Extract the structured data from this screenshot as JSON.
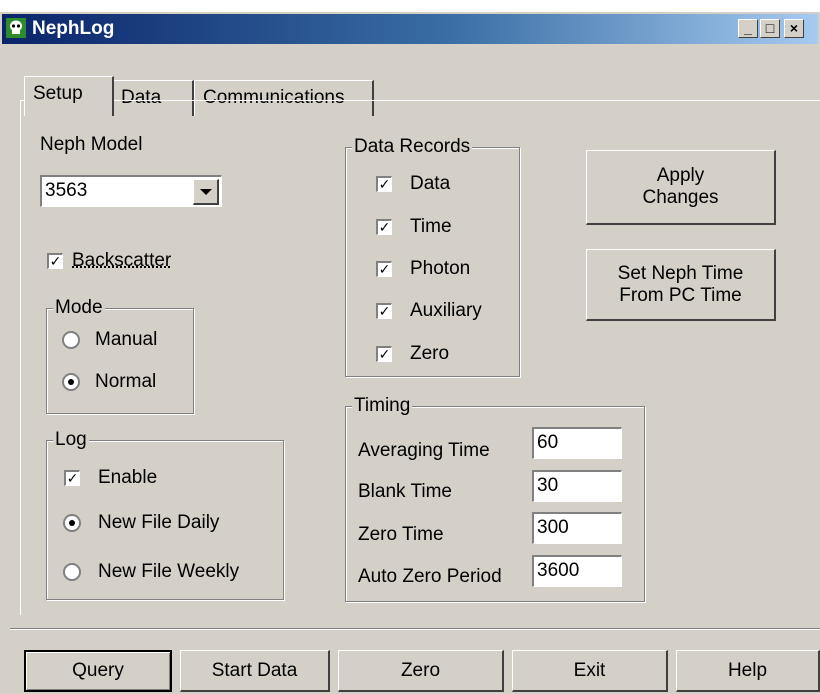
{
  "window": {
    "title": "NephLog"
  },
  "tabs": [
    "Setup",
    "Data",
    "Communications"
  ],
  "neph_model": {
    "label": "Neph Model",
    "value": "3563"
  },
  "backscatter": {
    "label": "Backscatter",
    "checked": true
  },
  "mode": {
    "title": "Mode",
    "options": [
      "Manual",
      "Normal"
    ],
    "selected": "Normal"
  },
  "log": {
    "title": "Log",
    "enable_label": "Enable",
    "options": [
      "New File Daily",
      "New File Weekly"
    ],
    "selected": "New File Daily"
  },
  "data_records": {
    "title": "Data Records",
    "items": [
      "Data",
      "Time",
      "Photon",
      "Auxiliary",
      "Zero"
    ]
  },
  "timing": {
    "title": "Timing",
    "fields": [
      {
        "label": "Averaging Time",
        "value": "60"
      },
      {
        "label": "Blank Time",
        "value": "30"
      },
      {
        "label": "Zero Time",
        "value": "300"
      },
      {
        "label": "Auto Zero Period",
        "value": "3600"
      }
    ]
  },
  "actions": {
    "apply_line1": "Apply",
    "apply_line2": "Changes",
    "settime_line1": "Set Neph Time",
    "settime_line2": "From PC Time"
  },
  "bottom_buttons": [
    "Query",
    "Start Data",
    "Zero",
    "Exit",
    "Help"
  ]
}
